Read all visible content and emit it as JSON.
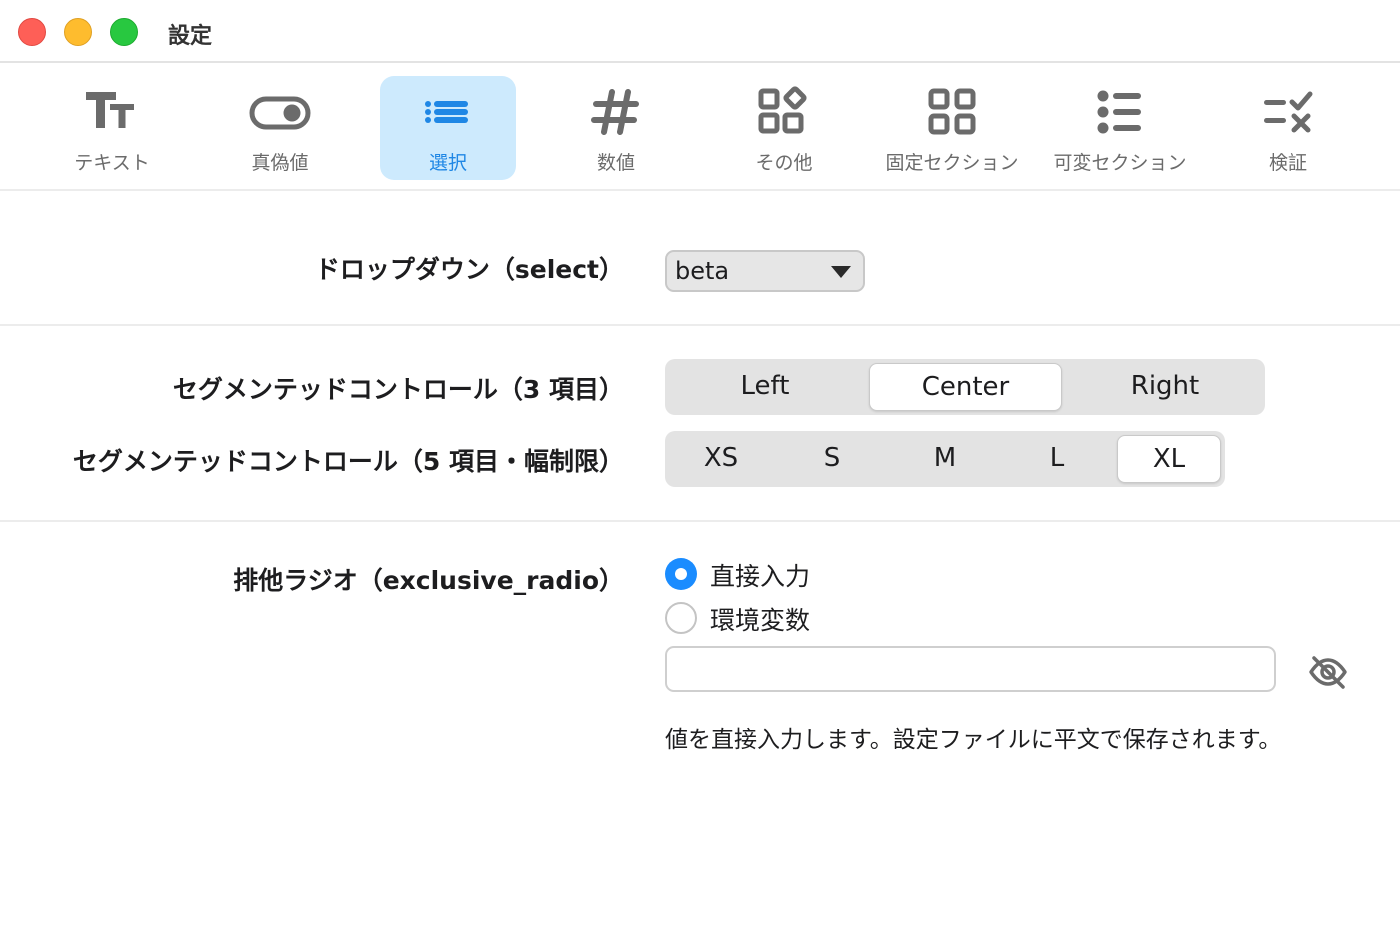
{
  "window": {
    "title": "設定"
  },
  "toolbar": {
    "items": [
      {
        "label": "テキスト",
        "icon": "text-format-icon",
        "active": false
      },
      {
        "label": "真偽値",
        "icon": "toggle-icon",
        "active": false
      },
      {
        "label": "選択",
        "icon": "list-select-icon",
        "active": true
      },
      {
        "label": "数値",
        "icon": "number-sign-icon",
        "active": false
      },
      {
        "label": "その他",
        "icon": "grid-diamond-icon",
        "active": false
      },
      {
        "label": "固定セクション",
        "icon": "grid-squares-icon",
        "active": false
      },
      {
        "label": "可変セクション",
        "icon": "bullet-list-icon",
        "active": false
      },
      {
        "label": "検証",
        "icon": "checklist-icon",
        "active": false
      }
    ]
  },
  "dropdown": {
    "label": "ドロップダウン（select）",
    "value": "beta"
  },
  "segmented3": {
    "label": "セグメンテッドコントロール（3 項目）",
    "options": [
      "Left",
      "Center",
      "Right"
    ],
    "selected": "Center"
  },
  "segmented5": {
    "label": "セグメンテッドコントロール（5 項目・幅制限）",
    "options": [
      "XS",
      "S",
      "M",
      "L",
      "XL"
    ],
    "selected": "XL"
  },
  "exclusive_radio": {
    "label": "排他ラジオ（exclusive_radio）",
    "options": [
      "直接入力",
      "環境変数"
    ],
    "selected": "直接入力",
    "input_value": "",
    "help": "値を直接入力します。設定ファイルに平文で保存されます。"
  },
  "colors": {
    "accent": "#1a8cff",
    "active_tab_bg": "#cdeafd",
    "active_tab_text": "#1f87e5",
    "icon_gray": "#6b6b6b"
  }
}
